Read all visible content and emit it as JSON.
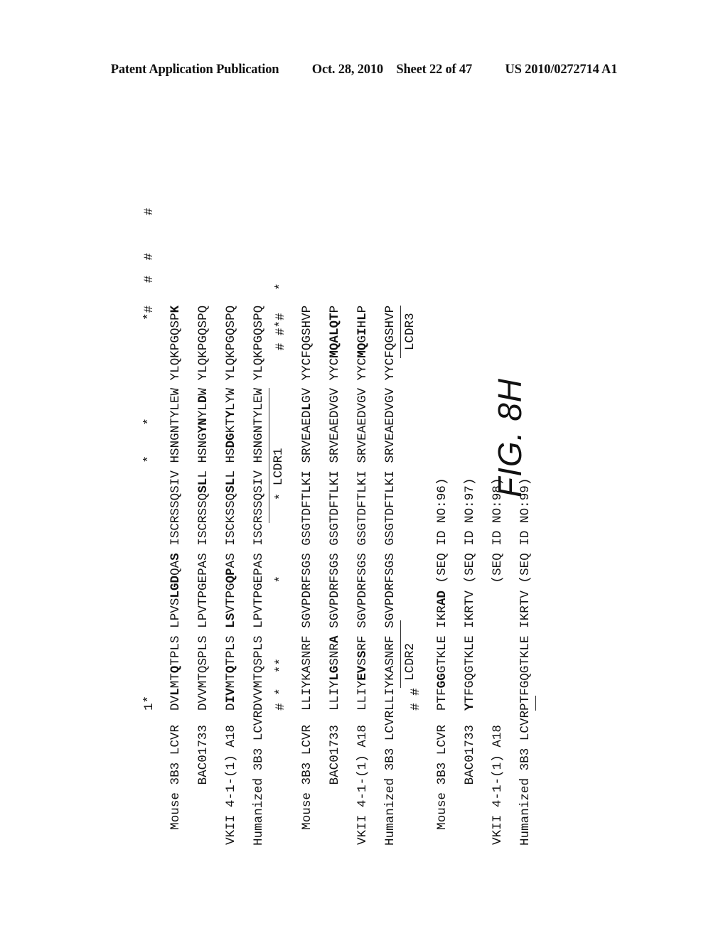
{
  "header": {
    "title": "Patent Application Publication",
    "date": "Oct. 28, 2010",
    "sheet": "Sheet 22 of 47",
    "pub_number": "US 2010/0272714 A1"
  },
  "figure_label": "FIG. 8H",
  "sequence_names": [
    "Mouse 3B3 LCVR",
    "BAC01733",
    "VKII 4-1-(1) A18",
    "Humanized 3B3 LCVR"
  ],
  "blocks": [
    {
      "marks": "1*                               *    *             *#   #  #     #",
      "rows": [
        [
          "DVLMTQTPLS",
          "LPVSLGDQAS",
          "ISCRSSQSIV",
          "HSNGNTYLEW",
          "YLQKPGQSPK"
        ],
        [
          "DVVMTQSPLS",
          "LPVTPGEPAS",
          "ISCRSSQSLL",
          "HSNGYNYLDW",
          "YLQKPGQSPQ"
        ],
        [
          "DIVMTQTPLS",
          "LSVTPGQPAS",
          "ISCKSSQSLL",
          "HSDGKTYLYW",
          "YLQKPGQSPQ"
        ],
        [
          "DVVMTQSPLS",
          "LPVTPGEPAS",
          "ISCRSSQSIV",
          "HSNGNTYLEW",
          "YLQKPGQSPQ"
        ]
      ],
      "cdr_label": "LCDR1"
    },
    {
      "marks": "# *  **          *          *                   # #*#   *",
      "rows": [
        [
          "LLIYKASNRF",
          "SGVPDRFSGS",
          "GSGTDFTLKI",
          "SRVEAEDLGV",
          "YYCFQGSHVP"
        ],
        [
          "LLIYLGSNRA",
          "SGVPDRFSGS",
          "GSGTDFTLKI",
          "SRVEAEDVGV",
          "YYCMQALQTP"
        ],
        [
          "LLIYEVSSRF",
          "SGVPDRFSGS",
          "GSGTDFTLKI",
          "SRVEAEDVGV",
          "YYCMQGIHLP"
        ],
        [
          "LLIYKASNRF",
          "SGVPDRFSGS",
          "GSGTDFTLKI",
          "SRVEAEDVGV",
          "YYCFQGSHVP"
        ]
      ],
      "cdr_labels": [
        "LCDR2",
        "LCDR3"
      ]
    },
    {
      "marks": "# #",
      "rows": [
        [
          "PTFGGGTKLE",
          "IKRAD",
          "(SEQ ID NO:96)"
        ],
        [
          "YTFGQGTKLE",
          "IKRTV",
          "(SEQ ID NO:97)"
        ],
        [
          "",
          "",
          "(SEQ ID NO:98)"
        ],
        [
          "PTFGQGTKLE",
          "IKRTV",
          "(SEQ ID NO:99)"
        ]
      ]
    }
  ]
}
